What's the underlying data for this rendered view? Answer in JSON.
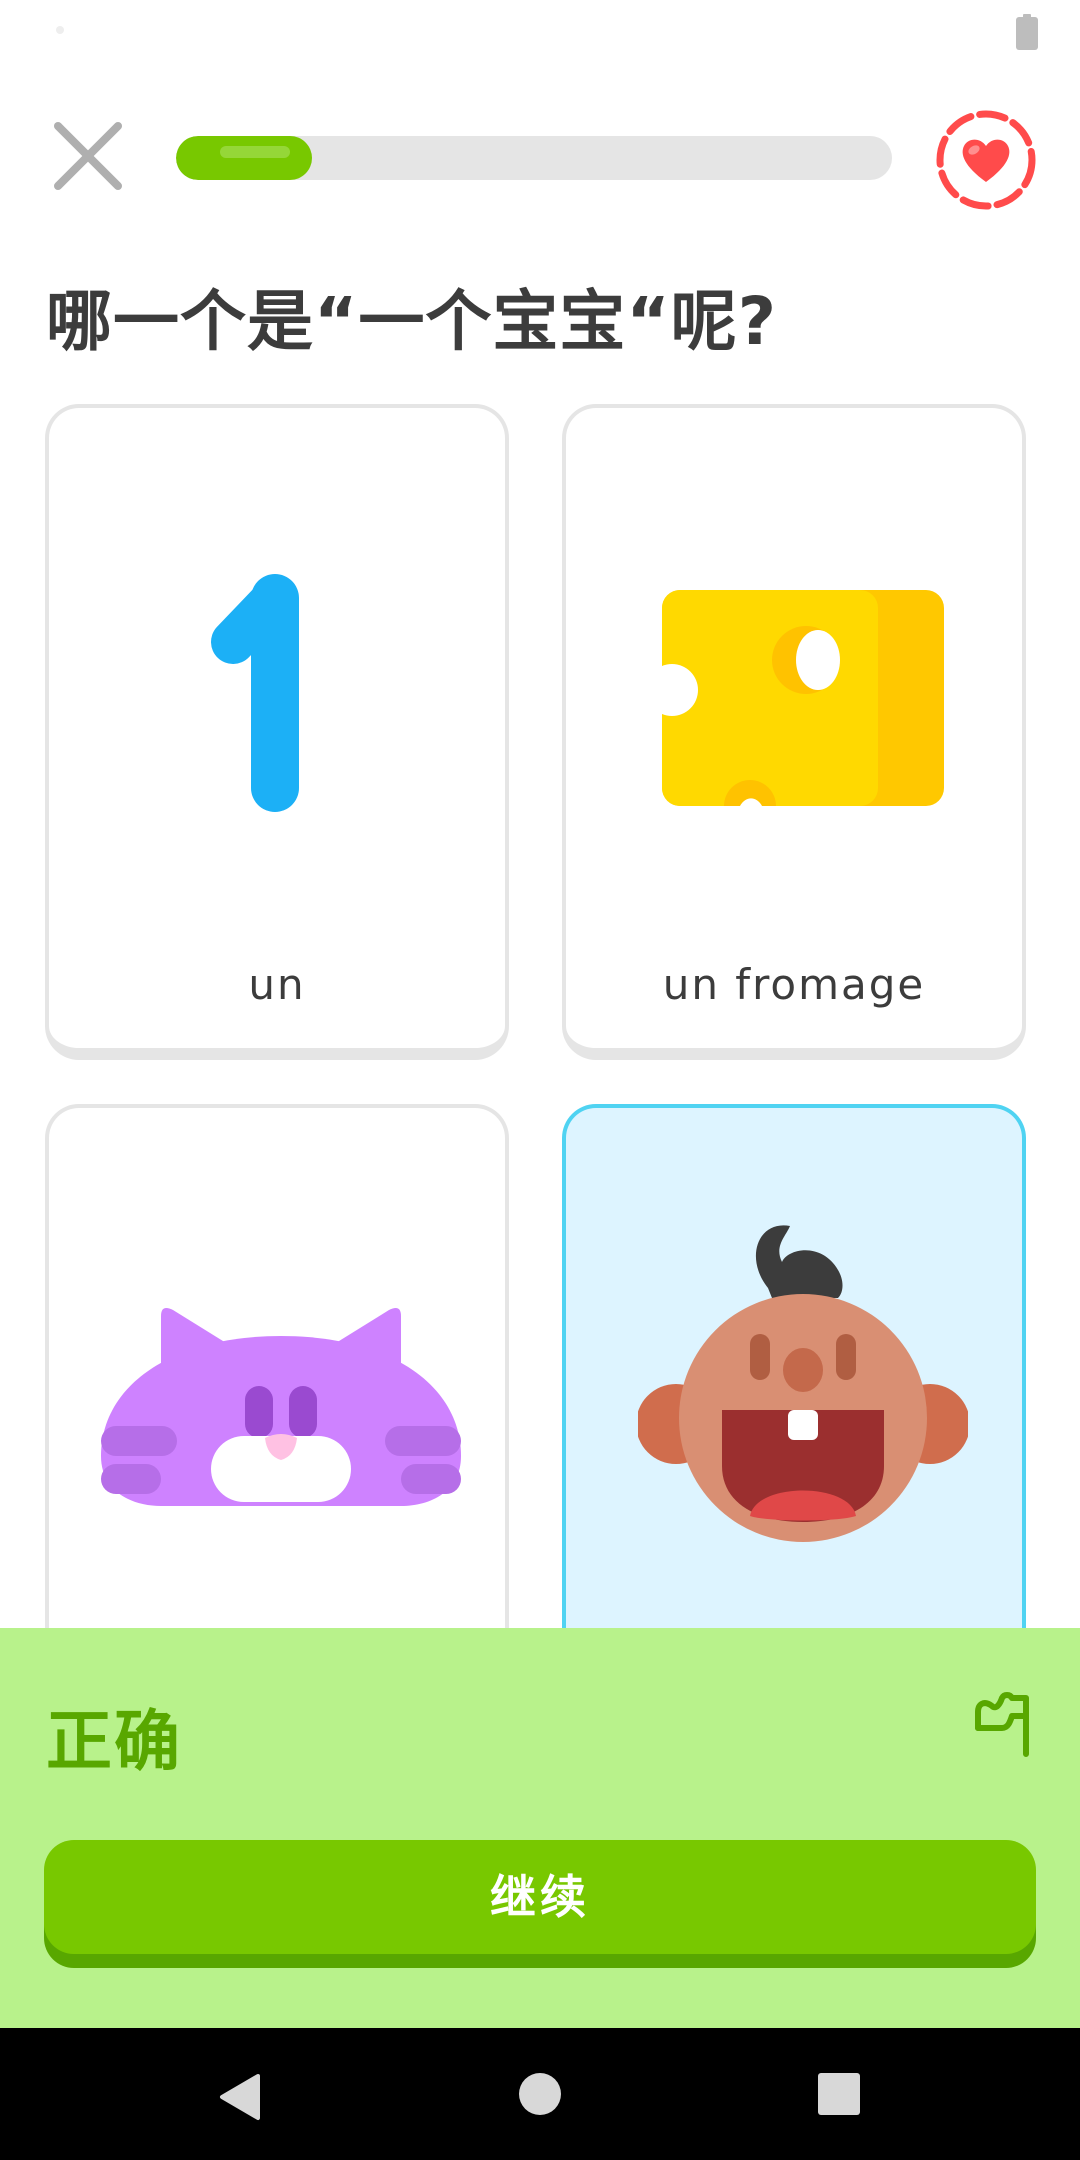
{
  "lesson": {
    "progress": 0.19,
    "question": "哪一个是“一个宝宝“呢?"
  },
  "choices": [
    {
      "label": "un",
      "image": "number-one-icon",
      "selected": false
    },
    {
      "label": "un fromage",
      "image": "cheese-icon",
      "selected": false
    },
    {
      "label": "",
      "image": "cat-icon",
      "selected": false
    },
    {
      "label": "",
      "image": "baby-icon",
      "selected": true
    }
  ],
  "feedback": {
    "title": "正确",
    "report_icon": "flag-icon",
    "continue_label": "继续"
  },
  "colors": {
    "accent_green": "#78c800",
    "feedback_bg": "#b8f28b",
    "feedback_text": "#58a700",
    "selected_border": "#4fd3f2",
    "selected_bg": "#ddf4ff",
    "heart_red": "#ff4b4b"
  },
  "icons": {
    "close": "close-icon",
    "heart": "heart-icon",
    "battery": "battery-icon",
    "nav_back": "back-triangle-icon",
    "nav_home": "home-circle-icon",
    "nav_recents": "recents-square-icon"
  }
}
